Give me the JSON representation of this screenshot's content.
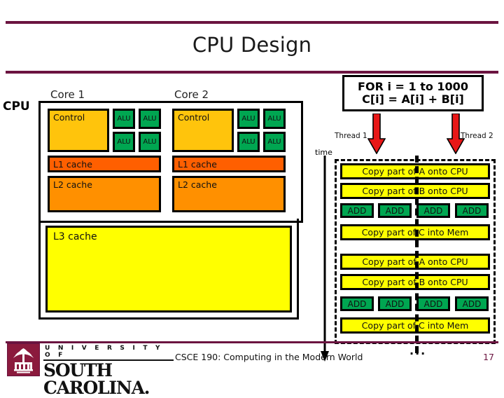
{
  "slide": {
    "title": "CPU Design",
    "accent_color": "#6B1440"
  },
  "cpu_diagram": {
    "cpu_label": "CPU",
    "core1_label": "Core 1",
    "core2_label": "Core 2",
    "cores": [
      {
        "name": "Core 1",
        "control_label": "Control",
        "alu_labels": [
          "ALU",
          "ALU",
          "ALU",
          "ALU"
        ],
        "l1_label": "L1 cache",
        "l2_label": "L2 cache"
      },
      {
        "name": "Core 2",
        "control_label": "Control",
        "alu_labels": [
          "ALU",
          "ALU",
          "ALU",
          "ALU"
        ],
        "l1_label": "L1 cache",
        "l2_label": "L2 cache"
      }
    ],
    "l3_label": "L3 cache",
    "colors": {
      "control": "#FFC40C",
      "alu": "#00A651",
      "l1": "#FF5F00",
      "l2": "#FF9000",
      "l3": "#FFFF00"
    }
  },
  "program": {
    "line1": "FOR i = 1 to 1000",
    "line2": "C[i] = A[i] + B[i]"
  },
  "threads": {
    "thread1_label": "Thread 1",
    "thread2_label": "Thread 2",
    "time_label": "time",
    "arrow_color": "#E81717",
    "continuation": "..."
  },
  "timeline": {
    "iterations": [
      {
        "steps": [
          {
            "type": "bar",
            "label": "Copy part of A onto CPU"
          },
          {
            "type": "bar",
            "label": "Copy part of B onto CPU"
          },
          {
            "type": "adds",
            "labels": [
              "ADD",
              "ADD",
              "ADD",
              "ADD"
            ]
          },
          {
            "type": "bar",
            "label": "Copy part of C into Mem"
          }
        ]
      },
      {
        "steps": [
          {
            "type": "bar",
            "label": "Copy part of A onto CPU"
          },
          {
            "type": "bar",
            "label": "Copy part of B onto CPU"
          },
          {
            "type": "adds",
            "labels": [
              "ADD",
              "ADD",
              "ADD",
              "ADD"
            ]
          },
          {
            "type": "bar",
            "label": "Copy part of C into Mem"
          }
        ]
      }
    ]
  },
  "footer": {
    "logo_university": "U N I V E R S I T Y   O F",
    "logo_name": "SOUTH CAROLINA.",
    "course": "CSCE 190:  Computing in the Modern World",
    "page": "17"
  }
}
